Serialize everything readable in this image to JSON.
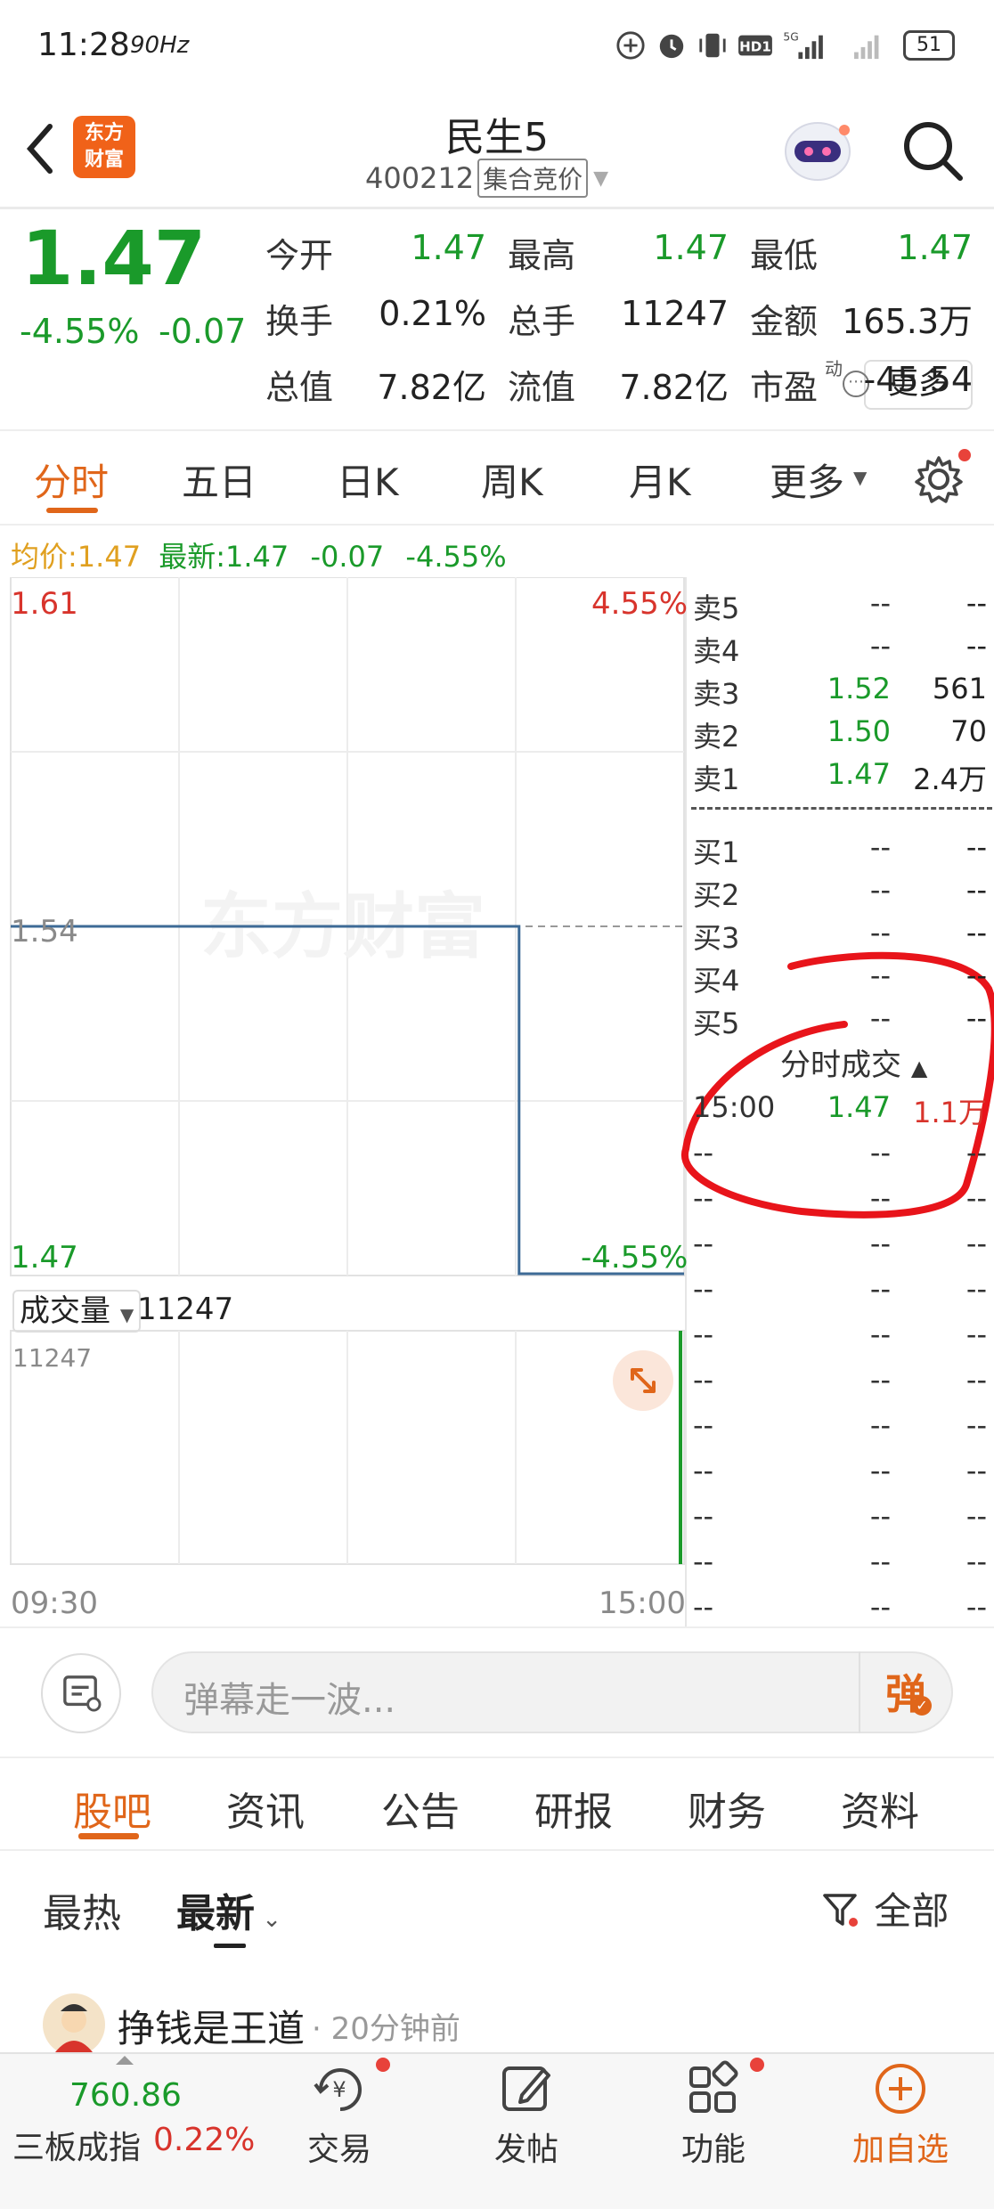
{
  "status_bar": {
    "time": "11:28",
    "refresh": "90Hz",
    "network": "5G",
    "battery": "51"
  },
  "header": {
    "title": "民生5",
    "code": "400212",
    "mode": "集合竞价",
    "logo_line1": "东方",
    "logo_line2": "财富"
  },
  "quote": {
    "price": "1.47",
    "change_pct": "-4.55%",
    "change_amt": "-0.07",
    "rows": [
      [
        {
          "label": "今开",
          "value": "1.47",
          "color": "green"
        },
        {
          "label": "最高",
          "value": "1.47",
          "color": "green"
        },
        {
          "label": "最低",
          "value": "1.47",
          "color": "green"
        }
      ],
      [
        {
          "label": "换手",
          "value": "0.21%",
          "color": "black"
        },
        {
          "label": "总手",
          "value": "11247",
          "color": "black"
        },
        {
          "label": "金额",
          "value": "165.3万",
          "color": "black"
        }
      ],
      [
        {
          "label": "总值",
          "value": "7.82亿",
          "color": "black"
        },
        {
          "label": "流值",
          "value": "7.82亿",
          "color": "black"
        },
        {
          "label": "市盈",
          "value": "-45.54",
          "color": "black",
          "superscript": "动"
        }
      ]
    ],
    "more_label": "更多"
  },
  "chart_tabs": [
    "分时",
    "五日",
    "日K",
    "周K",
    "月K",
    "更多"
  ],
  "active_chart_tab": "分时",
  "avg_row": {
    "avg_label": "均价:",
    "avg_value": "1.47",
    "latest_label": "最新:",
    "latest_value": "1.47",
    "change": "-0.07",
    "pct": "-4.55%"
  },
  "chart": {
    "y_top": "1.61",
    "y_mid": "1.54",
    "y_bottom": "1.47",
    "pct_top": "4.55%",
    "pct_bottom": "-4.55%",
    "x_start": "09:30",
    "x_end": "15:00",
    "watermark": "东方财富"
  },
  "chart_data": {
    "type": "line",
    "x": [
      "09:30",
      "15:00"
    ],
    "series": [
      {
        "values": [
          1.54,
          1.47
        ]
      }
    ],
    "ylim": [
      1.47,
      1.61
    ],
    "prev_close": 1.54,
    "volume": {
      "value": 11247,
      "ylim": [
        0,
        11247
      ]
    }
  },
  "volume": {
    "label": "成交量",
    "value": "11247",
    "axis_max": "11247"
  },
  "order_book": {
    "asks": [
      {
        "label": "卖5",
        "price": "--",
        "volume": "--"
      },
      {
        "label": "卖4",
        "price": "--",
        "volume": "--"
      },
      {
        "label": "卖3",
        "price": "1.52",
        "volume": "561"
      },
      {
        "label": "卖2",
        "price": "1.50",
        "volume": "70"
      },
      {
        "label": "卖1",
        "price": "1.47",
        "volume": "2.4万"
      }
    ],
    "bids": [
      {
        "label": "买1",
        "price": "--",
        "volume": "--"
      },
      {
        "label": "买2",
        "price": "--",
        "volume": "--"
      },
      {
        "label": "买3",
        "price": "--",
        "volume": "--"
      },
      {
        "label": "买4",
        "price": "--",
        "volume": "--"
      },
      {
        "label": "买5",
        "price": "--",
        "volume": "--"
      }
    ]
  },
  "trades": {
    "title": "分时成交",
    "rows": [
      {
        "time": "15:00",
        "price": "1.47",
        "volume": "1.1万"
      },
      {
        "time": "--",
        "price": "--",
        "volume": "--"
      },
      {
        "time": "--",
        "price": "--",
        "volume": "--"
      },
      {
        "time": "--",
        "price": "--",
        "volume": "--"
      },
      {
        "time": "--",
        "price": "--",
        "volume": "--"
      },
      {
        "time": "--",
        "price": "--",
        "volume": "--"
      },
      {
        "time": "--",
        "price": "--",
        "volume": "--"
      },
      {
        "time": "--",
        "price": "--",
        "volume": "--"
      },
      {
        "time": "--",
        "price": "--",
        "volume": "--"
      },
      {
        "time": "--",
        "price": "--",
        "volume": "--"
      },
      {
        "time": "--",
        "price": "--",
        "volume": "--"
      },
      {
        "time": "--",
        "price": "--",
        "volume": "--"
      }
    ]
  },
  "danmu": {
    "placeholder": "弹幕走一波...",
    "send_label": "弹"
  },
  "bottom_tabs": [
    "股吧",
    "资讯",
    "公告",
    "研报",
    "财务",
    "资料"
  ],
  "feed_filters": {
    "hot": "最热",
    "new": "最新",
    "all": "全部"
  },
  "post": {
    "author": "挣钱是王道",
    "time": "· 20分钟前"
  },
  "bottom_nav": {
    "index_value": "760.86",
    "index_name": "三板成指",
    "index_pct": "0.22%",
    "items": [
      "交易",
      "发帖",
      "功能",
      "加自选"
    ]
  },
  "colors": {
    "up": "#d8342c",
    "down": "#1a9a2a",
    "accent": "#e0661a",
    "line": "#3d6a96",
    "annotation": "#e8141a"
  }
}
